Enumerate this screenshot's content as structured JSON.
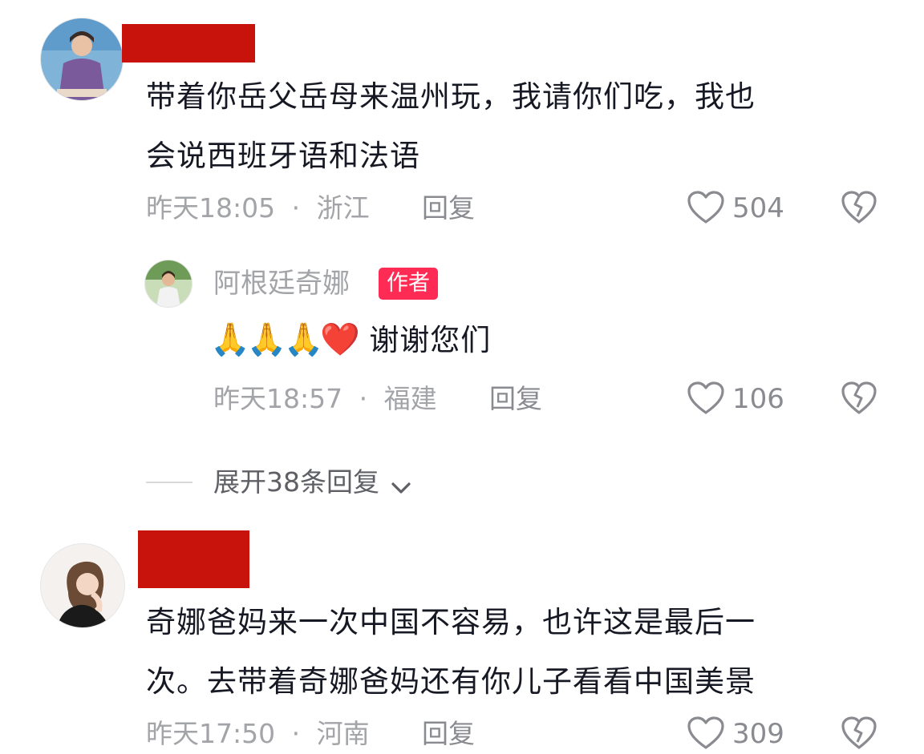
{
  "comments": [
    {
      "text_lines": [
        "带着你岳父岳母来温州玩，我请你们吃，我也",
        "会说西班牙语和法语"
      ],
      "time": "昨天18:05",
      "location": "浙江",
      "reply_label": "回复",
      "likes": "504"
    },
    {
      "text_lines": [
        "奇娜爸妈来一次中国不容易，也许这是最后一",
        "次。去带着奇娜爸妈还有你儿子看看中国美景"
      ],
      "time": "昨天17:50",
      "location": "河南",
      "reply_label": "回复",
      "likes": "309"
    }
  ],
  "reply": {
    "username": "阿根廷奇娜",
    "badge": "作者",
    "emojis": "🙏🙏🙏❤️",
    "text": "谢谢您们",
    "time": "昨天18:57",
    "location": "福建",
    "reply_label": "回复",
    "likes": "106"
  },
  "expand": {
    "label": "展开38条回复"
  },
  "separator": "·",
  "colors": {
    "redaction": "#c8120c",
    "badge": "#fe2c55",
    "text": "#161823",
    "meta": "#a3a4a8"
  },
  "icons": {
    "like": "heart-outline-icon",
    "dislike": "broken-heart-icon",
    "expand": "chevron-down-icon"
  }
}
